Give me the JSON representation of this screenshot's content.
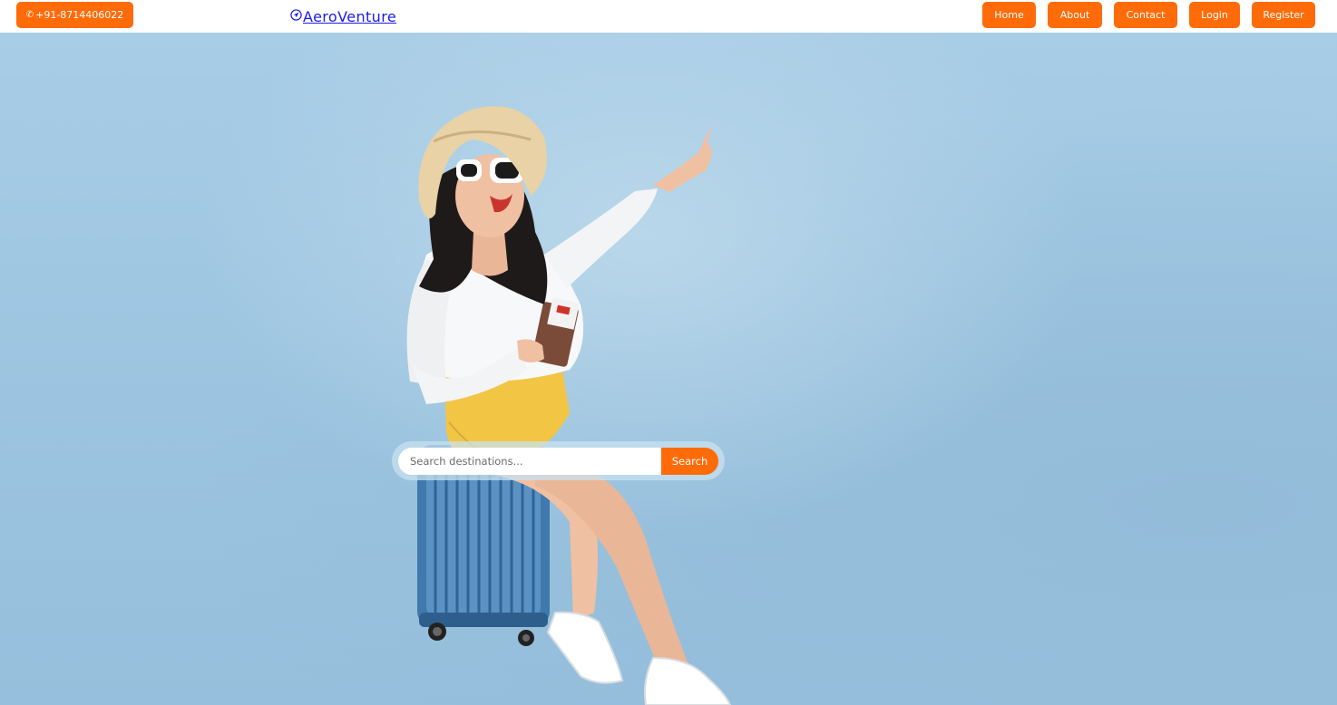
{
  "header": {
    "phone_label": "+91-8714406022",
    "brand": "AeroVenture",
    "nav": {
      "home": "Home",
      "about": "About",
      "contact": "Contact",
      "login": "Login",
      "register": "Register"
    }
  },
  "search": {
    "placeholder": "Search destinations...",
    "button_label": "Search"
  },
  "colors": {
    "accent": "#ff6b08",
    "brand_link": "#1a1aee",
    "hero_background": "#9fc6e0"
  },
  "icons": {
    "phone": "phone-icon",
    "logo": "paper-plane-icon"
  }
}
